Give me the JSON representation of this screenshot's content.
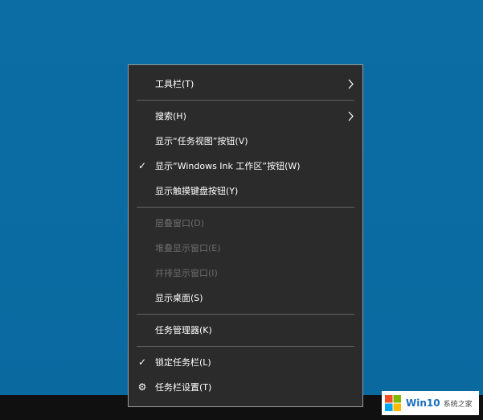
{
  "colors": {
    "desktop": "#0a6ba1",
    "menu_background": "#2b2b2b",
    "menu_text": "#ffffff",
    "menu_disabled_text": "#6d6d6d",
    "separator": "#646464",
    "taskbar": "#101010"
  },
  "menu": {
    "toolbar": {
      "label": "工具栏(T)",
      "has_submenu": true,
      "arrow_icon": "chevron-right-icon"
    },
    "search": {
      "label": "搜索(H)",
      "has_submenu": true,
      "arrow_icon": "chevron-right-icon"
    },
    "task_view": {
      "label": "显示“任务视图”按钮(V)"
    },
    "windows_ink": {
      "label": "显示“Windows Ink 工作区”按钮(W)",
      "checked": true,
      "check_glyph": "✓"
    },
    "touch_keyboard": {
      "label": "显示触摸键盘按钮(Y)"
    },
    "cascade": {
      "label": "层叠窗口(D)",
      "disabled": true
    },
    "stacked": {
      "label": "堆叠显示窗口(E)",
      "disabled": true
    },
    "side_by_side": {
      "label": "并排显示窗口(I)",
      "disabled": true
    },
    "show_desktop": {
      "label": "显示桌面(S)"
    },
    "task_manager": {
      "label": "任务管理器(K)"
    },
    "lock_taskbar": {
      "label": "锁定任务栏(L)",
      "checked": true,
      "check_glyph": "✓"
    },
    "taskbar_settings": {
      "label": "任务栏设置(T)",
      "icon": "gear-icon",
      "icon_glyph": "⚙"
    }
  },
  "watermark": {
    "brand": "Win10",
    "subtitle": "系统之家",
    "logo_colors": [
      "#f25022",
      "#7fba00",
      "#00a4ef",
      "#ffb900"
    ]
  }
}
